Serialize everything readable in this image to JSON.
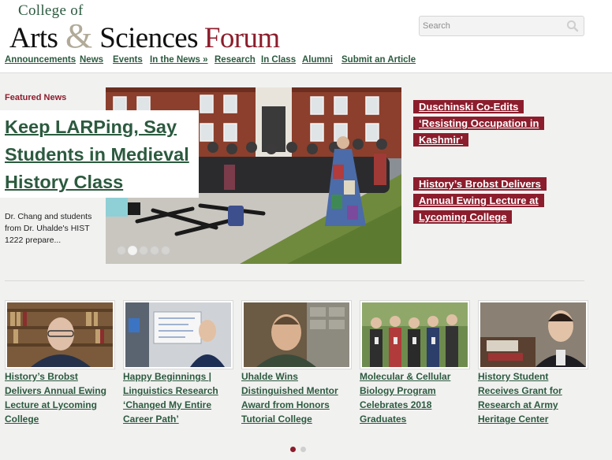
{
  "site": {
    "logo_line1": "College of",
    "logo_arts": "Arts",
    "logo_amp": "&",
    "logo_sciences": "Sciences",
    "logo_forum": "Forum"
  },
  "search": {
    "placeholder": "Search",
    "icon": "search-icon"
  },
  "nav": [
    {
      "label": "Announcements"
    },
    {
      "label": "News"
    },
    {
      "label": "Events"
    },
    {
      "label": "In the News »"
    },
    {
      "label": "Research"
    },
    {
      "label": "In Class"
    },
    {
      "label": "Alumni"
    },
    {
      "label": "Submit an Article"
    }
  ],
  "featured": {
    "label": "Featured News",
    "title": "Keep LARPing, Say Students in Medieval History Class",
    "excerpt": "Dr. Chang and students from Dr. Uhalde's HIST 1222 prepare...",
    "slides_total": 5,
    "slide_active": 2
  },
  "side_stories": [
    {
      "title": "Duschinski Co-Edits ‘Resisting Occupation in Kashmir’"
    },
    {
      "title": "History’s Brobst Delivers Annual Ewing Lecture at Lycoming College"
    }
  ],
  "cards": [
    {
      "title": "History’s Brobst Delivers Annual Ewing Lecture at Lycoming College"
    },
    {
      "title": "Happy Beginnings | Linguistics Research ‘Changed My Entire Career Path’"
    },
    {
      "title": "Uhalde Wins Distinguished Mentor Award from Honors Tutorial College"
    },
    {
      "title": "Molecular & Cellular Biology Program Celebrates 2018 Graduates"
    },
    {
      "title": "History Student Receives Grant for Research at Army Heritage Center"
    }
  ],
  "pager": {
    "pages": 2,
    "active": 1
  },
  "colors": {
    "brand_green": "#2c5a3f",
    "brand_maroon": "#8c1d2c",
    "background": "#f1f1f0"
  }
}
